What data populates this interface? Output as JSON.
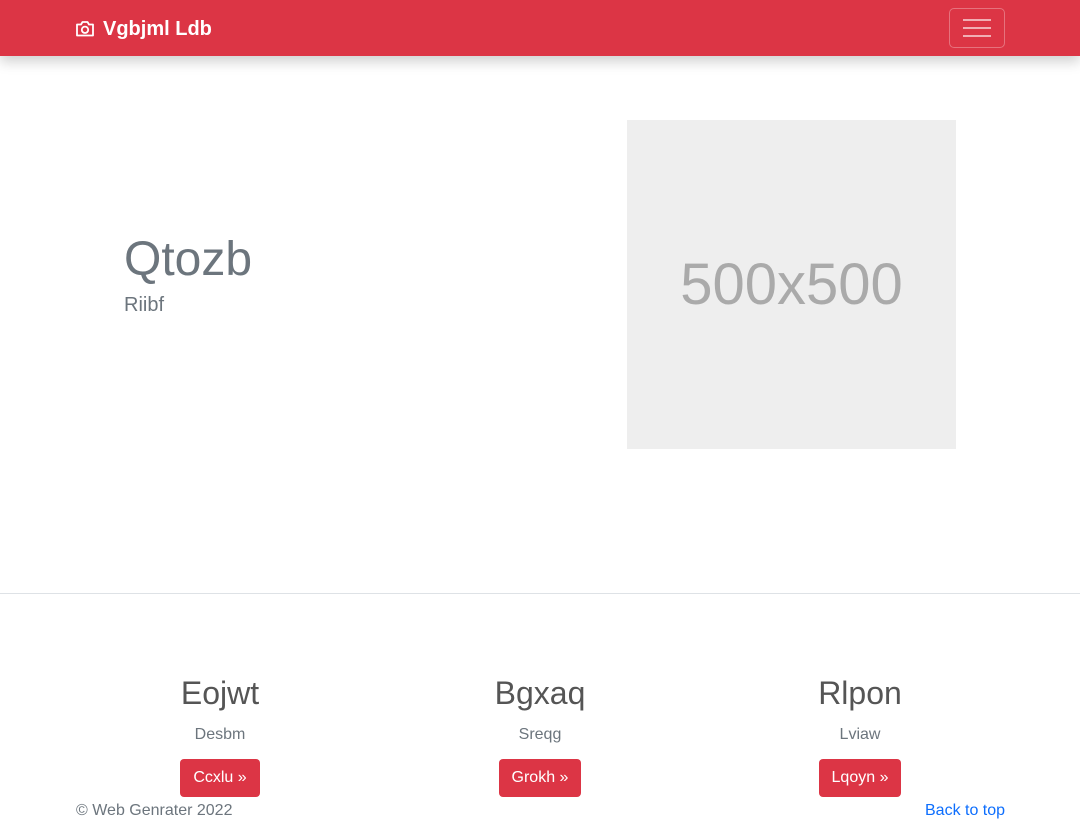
{
  "navbar": {
    "brand_label": "Vgbjml Ldb",
    "brand_icon": "camera-icon",
    "toggler_icon": "hamburger-menu-icon",
    "background_color": "#dc3545"
  },
  "hero": {
    "title": "Qtozb",
    "subtitle": "Riibf",
    "placeholder_text": "500x500"
  },
  "features": [
    {
      "title": "Eojwt",
      "text": "Desbm",
      "button_label": "Ccxlu »"
    },
    {
      "title": "Bgxaq",
      "text": "Sreqg",
      "button_label": "Grokh »"
    },
    {
      "title": "Rlpon",
      "text": "Lviaw",
      "button_label": "Lqoyn »"
    }
  ],
  "footer": {
    "copyright": "© Web Genrater 2022",
    "back_to_top": "Back to top"
  },
  "colors": {
    "accent": "#dc3545",
    "link": "#0d6efd",
    "muted": "#6c757d"
  }
}
